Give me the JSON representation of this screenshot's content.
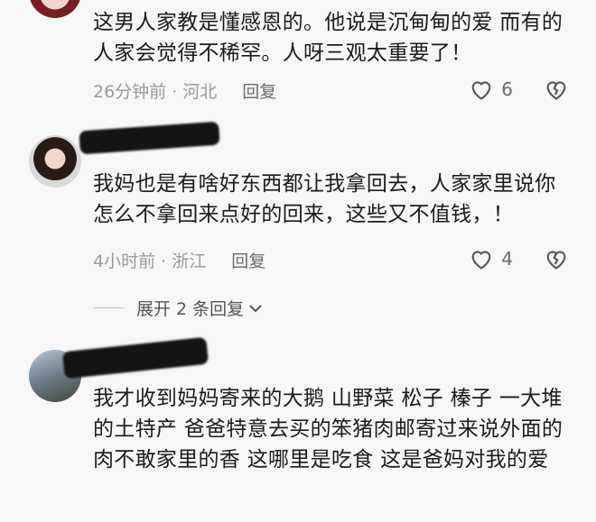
{
  "comments": [
    {
      "text": "这男人家教是懂感恩的。他说是沉甸甸的爱 而有的人家会觉得不稀罕。人呀三观太重要了！",
      "meta": "26分钟前 · 河北",
      "reply_label": "回复",
      "likes": "6"
    },
    {
      "text": "我妈也是有啥好东西都让我拿回去，人家家里说你怎么不拿回来点好的回来，这些又不值钱，！",
      "meta": "4小时前 · 浙江",
      "reply_label": "回复",
      "likes": "4"
    },
    {
      "text": "我才收到妈妈寄来的大鹅 山野菜 松子 榛子 一大堆的土特产 爸爸特意去买的笨猪肉邮寄过来说外面的肉不敢家里的香 这哪里是吃食 这是爸妈对我的爱"
    }
  ],
  "expand_label": "展开 2 条回复",
  "icons": {
    "like": "heart-outline-icon",
    "dislike": "broken-heart-icon",
    "expand": "chevron-down-icon"
  },
  "colors": {
    "background": "#f7f7f7",
    "meta": "#9a9a9a",
    "text": "#1b1b1b"
  }
}
